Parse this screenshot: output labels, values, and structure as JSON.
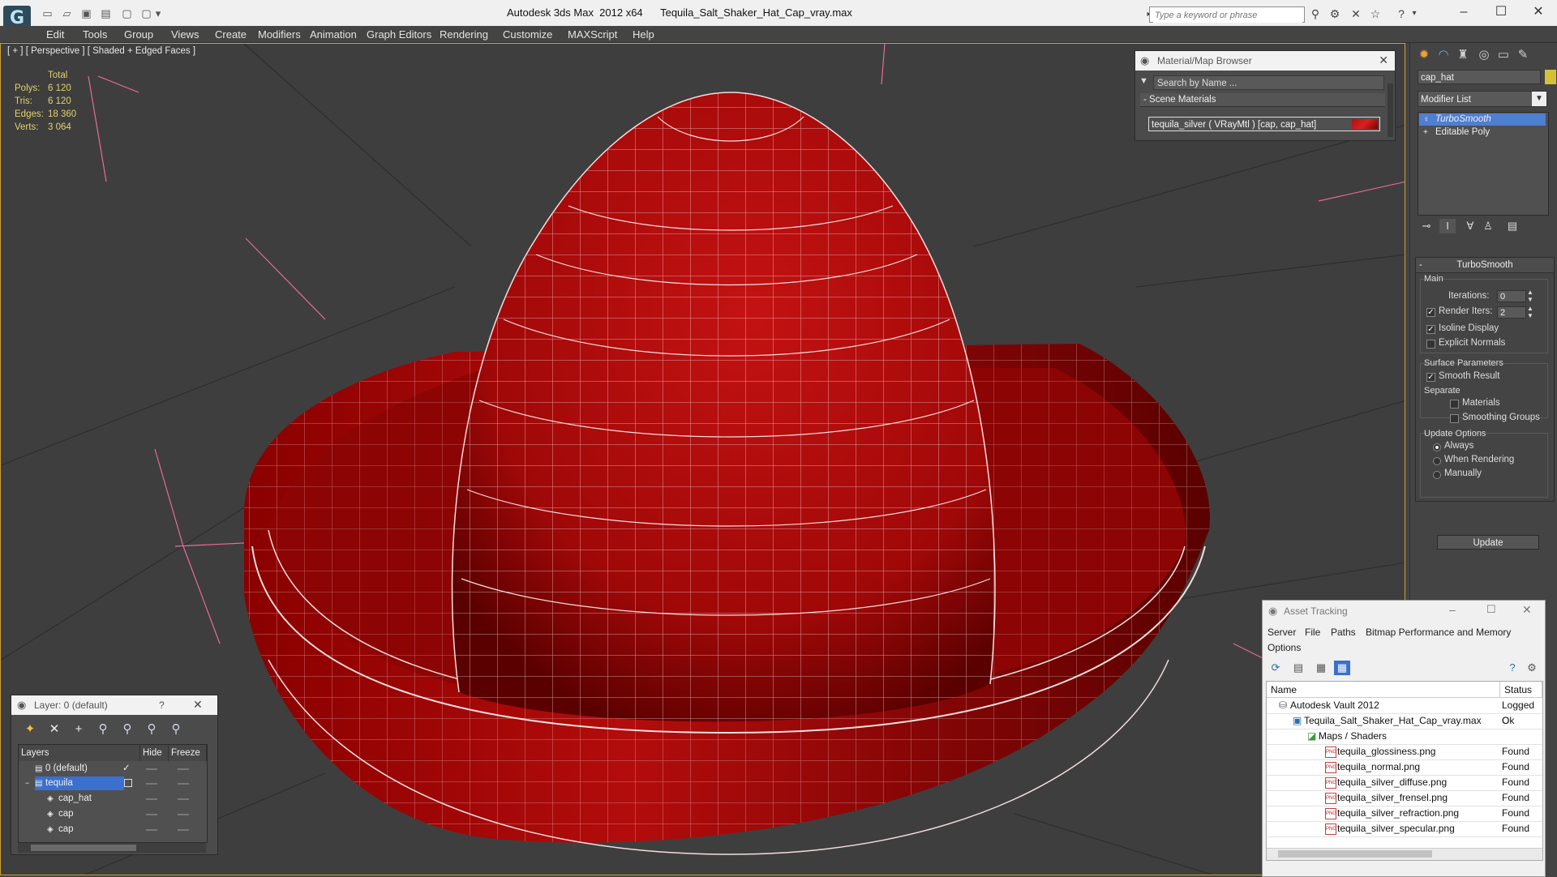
{
  "window": {
    "title": "Autodesk 3ds Max  2012 x64      Tequila_Salt_Shaker_Hat_Cap_vray.max",
    "search_placeholder": "Type a keyword or phrase",
    "logo_glyph": "G"
  },
  "menu": [
    "Edit",
    "Tools",
    "Group",
    "Views",
    "Create",
    "Modifiers",
    "Animation",
    "Graph Editors",
    "Rendering",
    "Customize",
    "MAXScript",
    "Help"
  ],
  "viewport": {
    "label": "[ + ] [ Perspective ] [ Shaded + Edged Faces ]",
    "stats": {
      "header": "Total",
      "rows": [
        {
          "label": "Polys:",
          "value": "6 120"
        },
        {
          "label": "Tris:",
          "value": "6 120"
        },
        {
          "label": "Edges:",
          "value": "18 360"
        },
        {
          "label": "Verts:",
          "value": "3 064"
        }
      ]
    }
  },
  "material_browser": {
    "title": "Material/Map Browser",
    "search": "Search by Name ...",
    "section": "- Scene Materials",
    "entry": "tequila_silver  ( VRayMtl )  [cap, cap_hat]",
    "swatch_color": "#c81414"
  },
  "command_panel": {
    "object_name": "cap_hat",
    "object_color": "#d4c236",
    "modifier_list": "Modifier List",
    "stack": [
      "TurboSmooth",
      "Editable Poly"
    ],
    "rollout_title": "TurboSmooth",
    "main_label": "Main",
    "iterations_label": "Iterations:",
    "iterations_value": "0",
    "render_iters_label": "Render Iters:",
    "render_iters_value": "2",
    "isoline": "Isoline Display",
    "explicit_normals": "Explicit Normals",
    "surface_params": "Surface Parameters",
    "smooth_result": "Smooth Result",
    "separate": "Separate",
    "materials": "Materials",
    "smoothing_groups": "Smoothing Groups",
    "update_options": "Update Options",
    "always": "Always",
    "when_rendering": "When Rendering",
    "manually": "Manually",
    "update_button": "Update"
  },
  "layer_dialog": {
    "title": "Layer: 0 (default)",
    "help": "?",
    "columns": [
      "Layers",
      "Hide",
      "Freeze"
    ],
    "rows": [
      {
        "name": "0 (default)"
      },
      {
        "name": "tequila"
      },
      {
        "name": "cap_hat"
      },
      {
        "name": "cap"
      },
      {
        "name": "cap"
      }
    ]
  },
  "asset_tracking": {
    "title": "Asset Tracking",
    "menu": [
      "Server",
      "File",
      "Paths",
      "Bitmap Performance and Memory",
      "Options"
    ],
    "columns": [
      "Name",
      "Status"
    ],
    "rows": [
      {
        "name": "Autodesk Vault 2012",
        "status": "Logged O"
      },
      {
        "name": "Tequila_Salt_Shaker_Hat_Cap_vray.max",
        "status": "Ok"
      },
      {
        "name": "Maps / Shaders",
        "status": ""
      },
      {
        "name": "tequila_glossiness.png",
        "status": "Found"
      },
      {
        "name": "tequila_normal.png",
        "status": "Found"
      },
      {
        "name": "tequila_silver_diffuse.png",
        "status": "Found"
      },
      {
        "name": "tequila_silver_frensel.png",
        "status": "Found"
      },
      {
        "name": "tequila_silver_refraction.png",
        "status": "Found"
      },
      {
        "name": "tequila_silver_specular.png",
        "status": "Found"
      }
    ]
  }
}
